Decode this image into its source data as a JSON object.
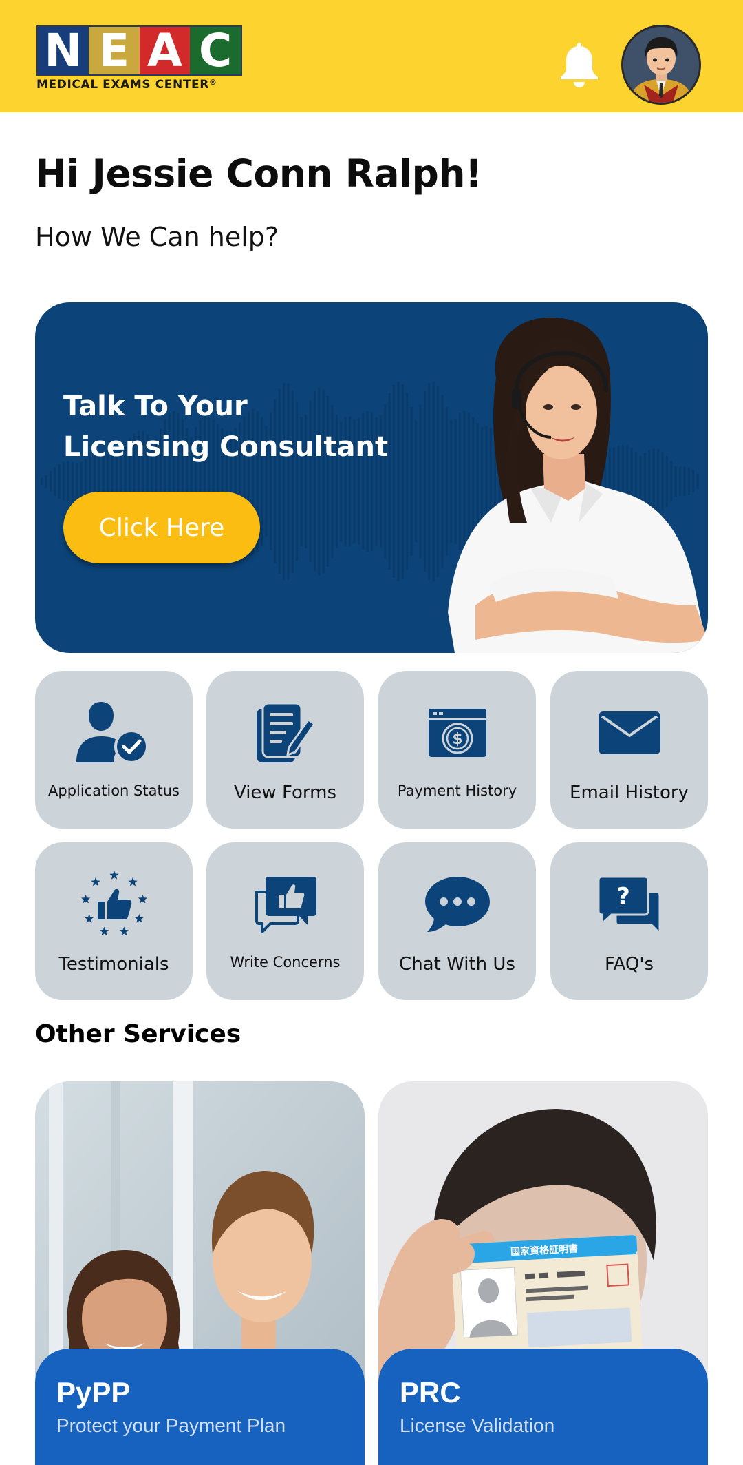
{
  "header": {
    "logo_letters": [
      "N",
      "E",
      "A",
      "C"
    ],
    "logo_letter_colors": [
      "#173e7a",
      "#c9a93e",
      "#d22a2a",
      "#1b6b2e"
    ],
    "logo_subtitle": "MEDICAL EXAMS CENTER",
    "logo_registered": "®",
    "bell_icon": "notification-bell-icon",
    "avatar_icon": "user-avatar"
  },
  "greeting": {
    "title": "Hi Jessie Conn Ralph!",
    "subtitle": "How We Can help?"
  },
  "banner": {
    "title_line1": "Talk To Your",
    "title_line2": "Licensing Consultant",
    "button_label": "Click Here",
    "background": "#0c4479",
    "button_color": "#fbbd12"
  },
  "services_grid": {
    "tiles": [
      {
        "label": "Application Status",
        "icon": "user-check-icon"
      },
      {
        "label": "View Forms",
        "icon": "forms-document-icon"
      },
      {
        "label": "Payment History",
        "icon": "payment-window-icon"
      },
      {
        "label": "Email History",
        "icon": "envelope-icon"
      },
      {
        "label": "Testimonials",
        "icon": "thumbs-up-stars-icon"
      },
      {
        "label": "Write Concerns",
        "icon": "thumbs-up-chat-icon"
      },
      {
        "label": "Chat With Us",
        "icon": "chat-bubble-icon"
      },
      {
        "label": "FAQ's",
        "icon": "question-chat-icon"
      }
    ],
    "tile_color": "#cdd4d9",
    "icon_color": "#0c4479"
  },
  "other_services": {
    "heading": "Other Services",
    "cards": [
      {
        "title": "PyPP",
        "subtitle": "Protect your Payment Plan"
      },
      {
        "title": "PRC",
        "subtitle": "License Validation",
        "card_header_text": "国家資格証明書"
      }
    ],
    "panel_color": "#1762bf"
  }
}
